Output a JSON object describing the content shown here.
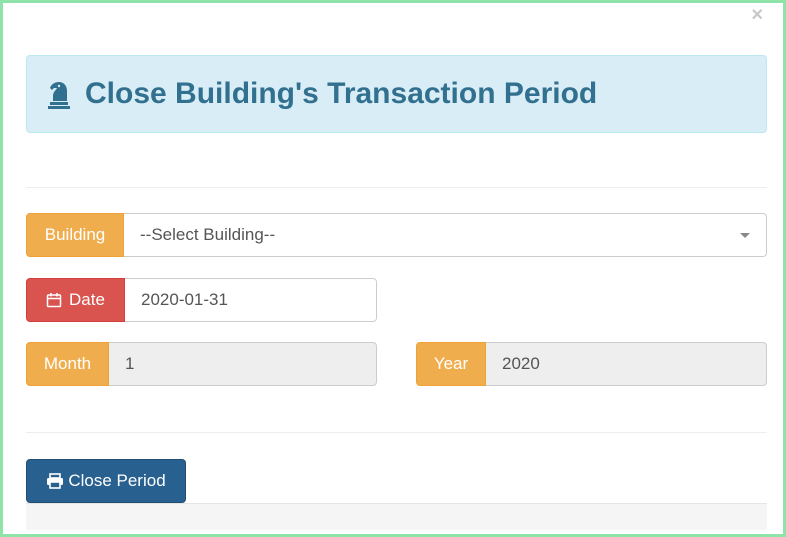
{
  "modal": {
    "close_symbol": "×",
    "title_icon": "chess-knight-icon",
    "title": "Close Building's Transaction Period"
  },
  "form": {
    "building": {
      "label": "Building",
      "selected": "--Select Building--"
    },
    "date": {
      "icon": "calendar-icon",
      "label": "Date",
      "value": "2020-01-31"
    },
    "month": {
      "label": "Month",
      "value": "1"
    },
    "year": {
      "label": "Year",
      "value": "2020"
    }
  },
  "actions": {
    "close_period_icon": "print-icon",
    "close_period_label": "Close Period"
  },
  "colors": {
    "alert_bg": "#d9edf7",
    "alert_text": "#31708f",
    "addon_warning": "#f0ad4e",
    "addon_danger": "#d9534f",
    "primary_button": "#286090",
    "modal_border": "#8de3a8"
  }
}
